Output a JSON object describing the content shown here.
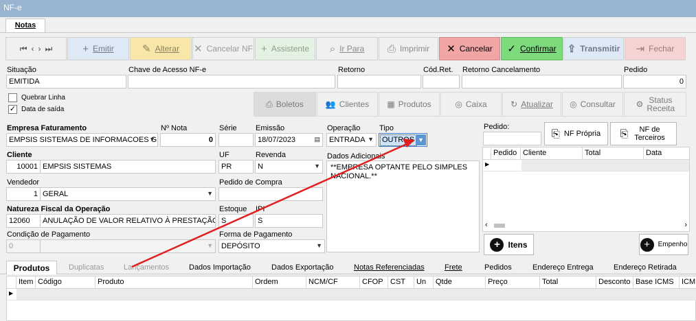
{
  "window": {
    "title": "NF-e"
  },
  "tabs": {
    "notas": "Notas"
  },
  "toolbar": {
    "emitir": "Emitir",
    "alterar": "Alterar",
    "cancelar_nf": "Cancelar NF",
    "assistente": "Assistente",
    "ir_para": "Ir Para",
    "imprimir": "Imprimir",
    "cancelar": "Cancelar",
    "confirmar": "Confirmar",
    "transmitir": "Transmitir",
    "fechar": "Fechar"
  },
  "status_row": {
    "situacao_label": "Situação",
    "situacao_value": "EMITIDA",
    "chave_label": "Chave de Acesso NF-e",
    "retorno_label": "Retorno",
    "codret_label": "Cód.Ret.",
    "retorno_cancel_label": "Retorno Cancelamento",
    "pedido_label": "Pedido",
    "pedido_value": "0"
  },
  "options": {
    "quebrar_linha": "Quebrar Linha",
    "data_saida": "Data de saída"
  },
  "actions": {
    "boletos": "Boletos",
    "clientes": "Clientes",
    "produtos": "Produtos",
    "caixa": "Caixa",
    "atualizar": "Atualizar",
    "consultar": "Consultar",
    "status_receita": "Status Receita"
  },
  "form": {
    "empresa_label": "Empresa Faturamento",
    "empresa_value": "EMPSIS SISTEMAS DE INFORMACOES GEI",
    "nnota_label": "Nº Nota",
    "nnota_value": "0",
    "serie_label": "Série",
    "serie_value": "",
    "emissao_label": "Emissão",
    "emissao_value": "18/07/2023",
    "operacao_label": "Operação",
    "operacao_value": "ENTRADA",
    "tipo_label": "Tipo",
    "tipo_value": "OUTROS",
    "cliente_label": "Cliente",
    "cliente_code": "10001",
    "cliente_name": "EMPSIS SISTEMAS",
    "uf_label": "UF",
    "uf_value": "PR",
    "revenda_label": "Revenda",
    "revenda_value": "N",
    "dados_label": "Dados Adicionais",
    "dados_value": "**EMPRESA OPTANTE PELO SIMPLES NACIONAL.**",
    "vendedor_label": "Vendedor",
    "vendedor_code": "1",
    "vendedor_name": "GERAL",
    "pedido_compra_label": "Pedido de Compra",
    "natureza_label": "Natureza Fiscal da Operação",
    "natureza_code": "12060",
    "natureza_name": "ANULAÇÃO DE VALOR RELATIVO À PRESTAÇÃO D",
    "estoque_label": "Estoque",
    "estoque_value": "S",
    "ipi_label": "IPI",
    "ipi_value": "S",
    "condicao_label": "Condição de Pagamento",
    "condicao_value": "0",
    "forma_label": "Forma de Pagamento",
    "forma_value": "DEPÓSITO"
  },
  "right_panel": {
    "pedido_label": "Pedido:",
    "nf_propria": "NF Própria",
    "nf_terceiros": "NF de Terceiros",
    "cols": [
      "Pedido",
      "Cliente",
      "Total",
      "Data"
    ],
    "itens": "Itens",
    "empenho": "Empenho"
  },
  "bottom_tabs": [
    "Produtos",
    "Duplicatas",
    "Lançamentos",
    "Dados Importação",
    "Dados Exportação",
    "Notas Referenciadas",
    "Frete",
    "Pedidos",
    "Endereço Entrega",
    "Endereço Retirada"
  ],
  "products_grid": {
    "cols": [
      "Item",
      "Código",
      "Produto",
      "Ordem",
      "NCM/CF",
      "CFOP",
      "CST",
      "Un",
      "Qtde",
      "Preço",
      "Total",
      "Desconto",
      "Base ICMS",
      "ICM"
    ]
  },
  "colors": {
    "titlebar": "#99b4d1",
    "cancel": "#f1a5a5",
    "confirm": "#7ddb7d",
    "alterar": "#f8e08e",
    "arrow": "#e02020",
    "tipo_sel": "#cde3f9"
  }
}
